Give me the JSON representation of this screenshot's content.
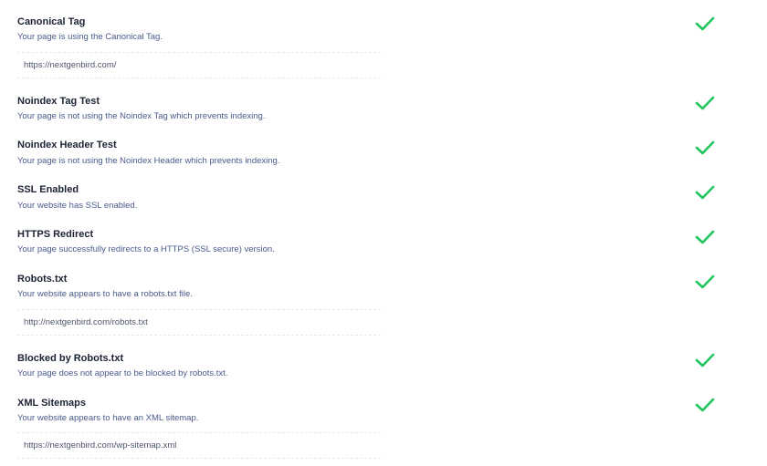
{
  "checks": [
    {
      "title": "Canonical Tag",
      "desc": "Your page is using the Canonical Tag.",
      "url": "https://nextgenbird.com/",
      "status": "passed"
    },
    {
      "title": "Noindex Tag Test",
      "desc": "Your page is not using the Noindex Tag which prevents indexing.",
      "status": "passed"
    },
    {
      "title": "Noindex Header Test",
      "desc": "Your page is not using the Noindex Header which prevents indexing.",
      "status": "passed"
    },
    {
      "title": "SSL Enabled",
      "desc": "Your website has SSL enabled.",
      "status": "passed"
    },
    {
      "title": "HTTPS Redirect",
      "desc": "Your page successfully redirects to a HTTPS (SSL secure) version.",
      "status": "passed"
    },
    {
      "title": "Robots.txt",
      "desc": "Your website appears to have a robots.txt file.",
      "url": "http://nextgenbird.com/robots.txt",
      "status": "passed"
    },
    {
      "title": "Blocked by Robots.txt",
      "desc": "Your page does not appear to be blocked by robots.txt.",
      "status": "passed"
    },
    {
      "title": "XML Sitemaps",
      "desc": "Your website appears to have an XML sitemap.",
      "url": "https://nextgenbird.com/wp-sitemap.xml",
      "status": "passed"
    }
  ],
  "colors": {
    "check": "#22c55e",
    "title": "#1b2333",
    "desc": "#4a5a8c"
  },
  "icons": {
    "pass": "check-icon"
  }
}
